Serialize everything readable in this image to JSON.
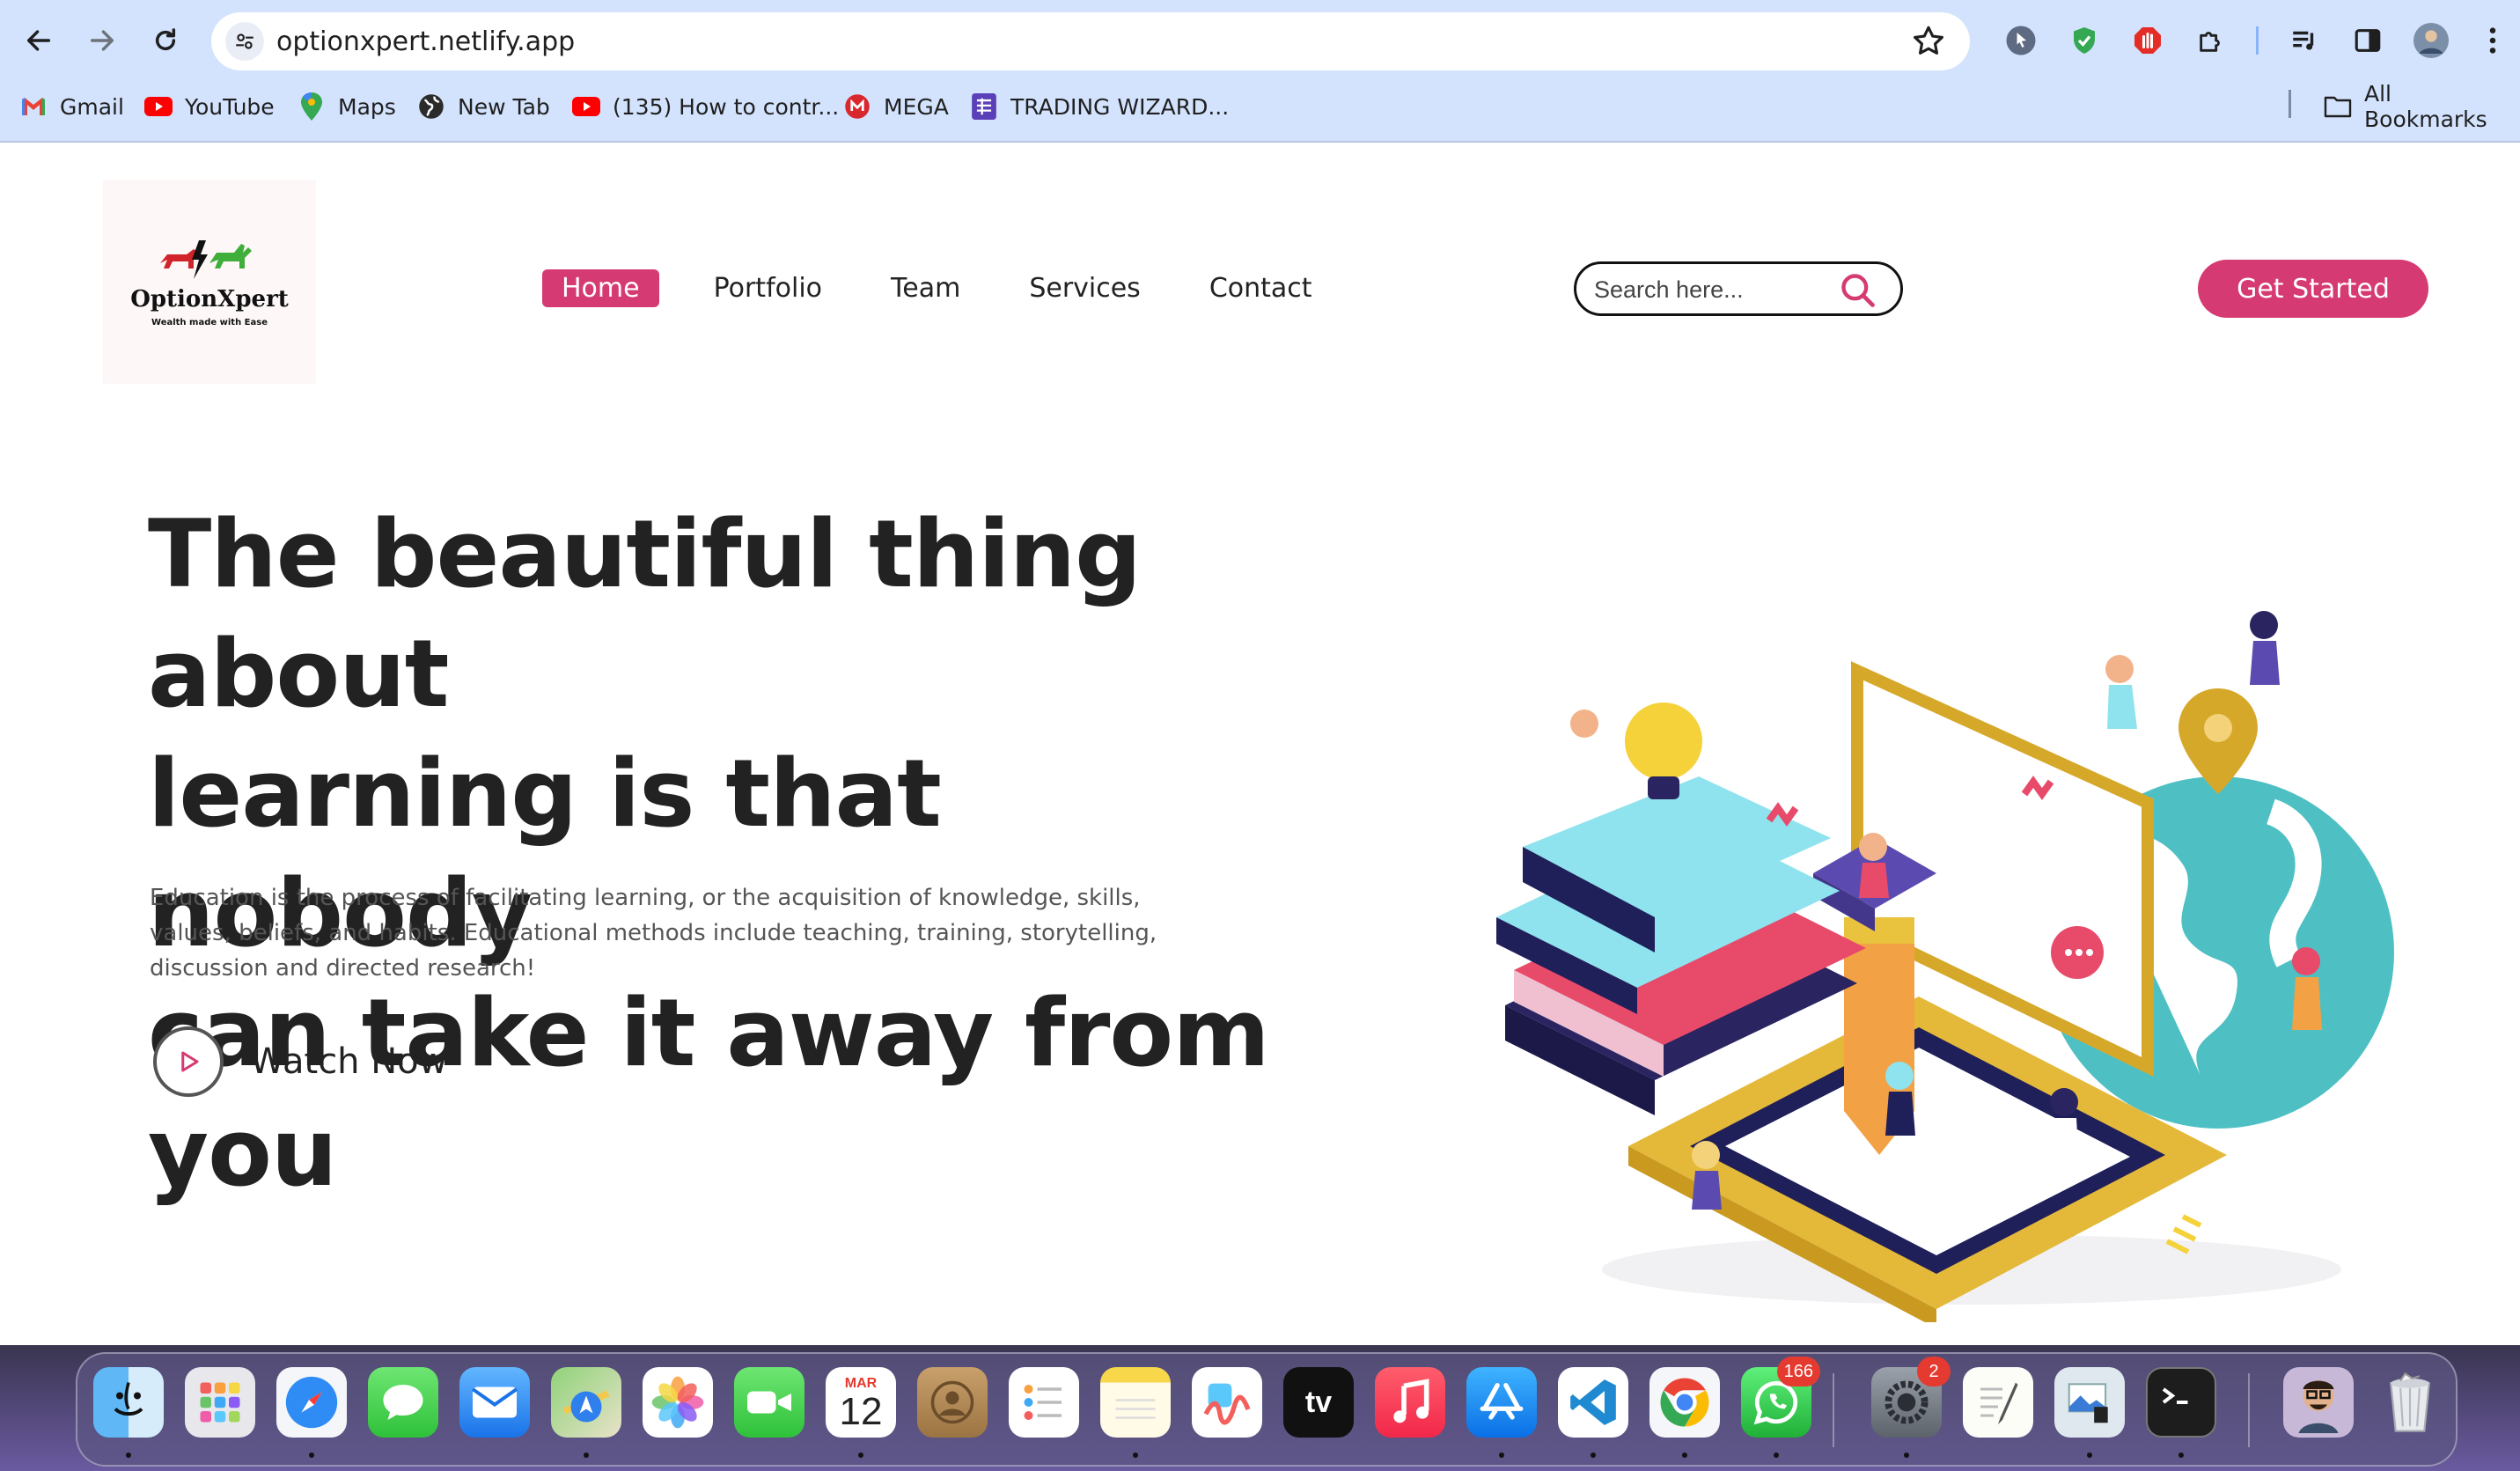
{
  "browser": {
    "url": "optionxpert.netlify.app",
    "bookmarks": [
      {
        "label": "Gmail",
        "icon": "gmail-icon"
      },
      {
        "label": "YouTube",
        "icon": "youtube-icon"
      },
      {
        "label": "Maps",
        "icon": "maps-icon"
      },
      {
        "label": "New Tab",
        "icon": "globe-icon"
      },
      {
        "label": "(135) How to contr...",
        "icon": "youtube-icon"
      },
      {
        "label": "MEGA",
        "icon": "mega-icon"
      },
      {
        "label": "TRADING WIZARD...",
        "icon": "sheets-icon"
      }
    ],
    "all_bookmarks": "All Bookmarks"
  },
  "site": {
    "logo_name": "OptionXpert",
    "logo_tagline": "Wealth made with Ease",
    "nav": [
      "Home",
      "Portfolio",
      "Team",
      "Services",
      "Contact"
    ],
    "active_nav": "Home",
    "search_placeholder": "Search here...",
    "cta": "Get Started",
    "hero_title_lines": [
      "The beautiful thing about",
      "learning is that nobody",
      "can take it away from you"
    ],
    "hero_text": "Education is the process of facilitating learning, or the acquisition of knowledge, skills, values, beliefs, and habits. Educational methods include teaching, training, storytelling, discussion and directed research!",
    "watch_label": "Watch Now",
    "accent": "#d63a72"
  },
  "dock": {
    "calendar_month": "MAR",
    "calendar_day": "12",
    "tv_label": "tv",
    "badges": {
      "whatsapp": "166",
      "settings": "2"
    },
    "apps": [
      "finder",
      "launchpad",
      "safari",
      "messages",
      "mail",
      "maps",
      "photos",
      "facetime",
      "calendar",
      "contacts",
      "reminders",
      "notes",
      "freeform",
      "tv",
      "music",
      "app-store",
      "vscode",
      "chrome",
      "whatsapp",
      "system-settings",
      "textedit",
      "preview",
      "terminal",
      "downloads",
      "trash"
    ]
  }
}
